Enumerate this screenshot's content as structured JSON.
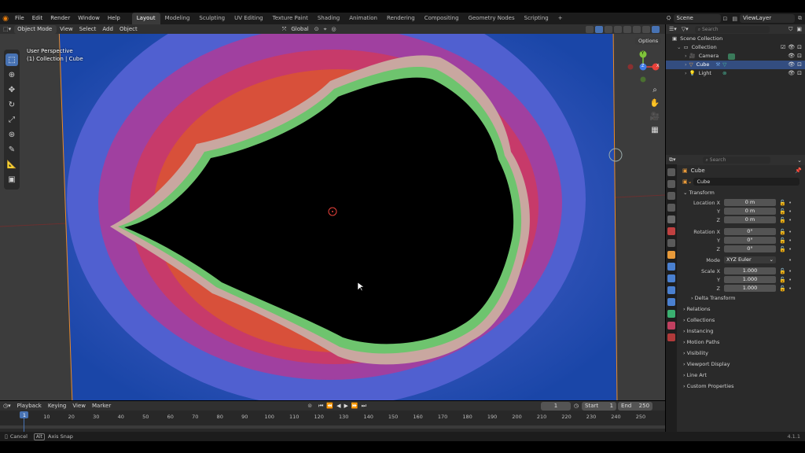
{
  "topbar": {
    "menus": [
      "File",
      "Edit",
      "Render",
      "Window",
      "Help"
    ],
    "workspaces": [
      "Layout",
      "Modeling",
      "Sculpting",
      "UV Editing",
      "Texture Paint",
      "Shading",
      "Animation",
      "Rendering",
      "Compositing",
      "Geometry Nodes",
      "Scripting"
    ],
    "active_workspace": "Layout",
    "add_tab": "+",
    "scene": "Scene",
    "view_layer": "ViewLayer"
  },
  "viewport_header": {
    "mode": "Object Mode",
    "menus": [
      "View",
      "Select",
      "Add",
      "Object"
    ],
    "orientation": "Global",
    "options": "Options"
  },
  "viewport": {
    "perspective": "User Perspective",
    "collection_info": "(1) Collection | Cube",
    "gizmo": {
      "x": "X",
      "y": "Y",
      "z": "Z"
    }
  },
  "outliner": {
    "search_placeholder": "Search",
    "items": [
      {
        "label": "Scene Collection",
        "selected": false
      },
      {
        "label": "Collection",
        "selected": false
      },
      {
        "label": "Camera",
        "selected": false
      },
      {
        "label": "Cube",
        "selected": true
      },
      {
        "label": "Light",
        "selected": false
      }
    ]
  },
  "properties": {
    "search_placeholder": "Search",
    "object_name": "Cube",
    "object_field": "Cube",
    "transform_title": "Transform",
    "location": {
      "label": "Location X",
      "x": "0 m",
      "y": "0 m",
      "z": "0 m"
    },
    "rotation": {
      "label": "Rotation X",
      "x": "0°",
      "y": "0°",
      "z": "0°"
    },
    "mode_label": "Mode",
    "mode_value": "XYZ Euler",
    "scale": {
      "label": "Scale X",
      "x": "1.000",
      "y": "1.000",
      "z": "1.000"
    },
    "axis_y": "Y",
    "axis_z": "Z",
    "delta_transform": "Delta Transform",
    "sections": [
      "Relations",
      "Collections",
      "Instancing",
      "Motion Paths",
      "Visibility",
      "Viewport Display",
      "Line Art",
      "Custom Properties"
    ]
  },
  "timeline": {
    "menus": [
      "Playback",
      "Keying",
      "View",
      "Marker"
    ],
    "current_frame": "1",
    "start_label": "Start",
    "start": "1",
    "end_label": "End",
    "end": "250",
    "frame_marks": [
      "1",
      "10",
      "20",
      "30",
      "40",
      "50",
      "60",
      "70",
      "80",
      "90",
      "100",
      "110",
      "120",
      "130",
      "140",
      "150",
      "160",
      "170",
      "180",
      "190",
      "200",
      "210",
      "220",
      "230",
      "240",
      "250"
    ]
  },
  "statusbar": {
    "cancel": "Cancel",
    "alt": "Alt",
    "axis_snap": "Axis Snap",
    "version": "4.1.1"
  },
  "colors": {
    "accent": "#4772b3",
    "selection": "#334d80",
    "x_axis": "#e8413a",
    "y_axis": "#7fc43a",
    "z_axis": "#3f7be6"
  }
}
